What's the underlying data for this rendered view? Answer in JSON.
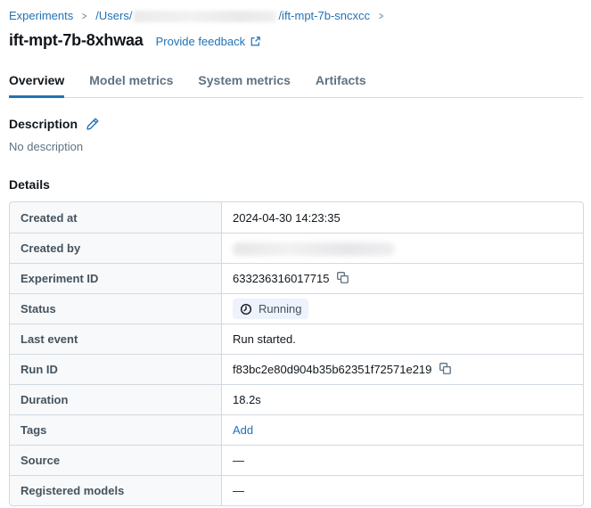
{
  "breadcrumb": {
    "experiments_label": "Experiments",
    "separator": ">",
    "path_prefix": "/Users/",
    "path_redacted": true,
    "path_suffix": "/ift-mpt-7b-sncxcc",
    "trailing_separator": ">"
  },
  "header": {
    "title": "ift-mpt-7b-8xhwaa",
    "feedback_label": "Provide feedback"
  },
  "tabs": [
    {
      "label": "Overview",
      "active": true
    },
    {
      "label": "Model metrics",
      "active": false
    },
    {
      "label": "System metrics",
      "active": false
    },
    {
      "label": "Artifacts",
      "active": false
    }
  ],
  "description": {
    "heading": "Description",
    "empty_text": "No description"
  },
  "details": {
    "heading": "Details",
    "rows": [
      {
        "label": "Created at",
        "value": "2024-04-30 14:23:35",
        "type": "text"
      },
      {
        "label": "Created by",
        "value": "",
        "type": "redacted"
      },
      {
        "label": "Experiment ID",
        "value": "633236316017715",
        "type": "copyable"
      },
      {
        "label": "Status",
        "value": "Running",
        "type": "status"
      },
      {
        "label": "Last event",
        "value": "Run started.",
        "type": "text"
      },
      {
        "label": "Run ID",
        "value": "f83bc2e80d904b35b62351f72571e219",
        "type": "copyable"
      },
      {
        "label": "Duration",
        "value": "18.2s",
        "type": "text"
      },
      {
        "label": "Tags",
        "value": "Add",
        "type": "link"
      },
      {
        "label": "Source",
        "value": "—",
        "type": "text"
      },
      {
        "label": "Registered models",
        "value": "—",
        "type": "text"
      }
    ]
  },
  "colors": {
    "link_blue": "#2272B4",
    "active_tab_underline": "#2272B4",
    "label_text": "#44535F",
    "value_text": "#11171C",
    "muted_text": "#5F7281",
    "table_border": "#D1D9E0",
    "label_column_bg": "#F8F9FA",
    "status_badge_bg": "#EDF2FB"
  },
  "icons": {
    "pencil": "edit-pencil",
    "external_link": "external-link",
    "copy": "copy",
    "clock": "clock"
  }
}
